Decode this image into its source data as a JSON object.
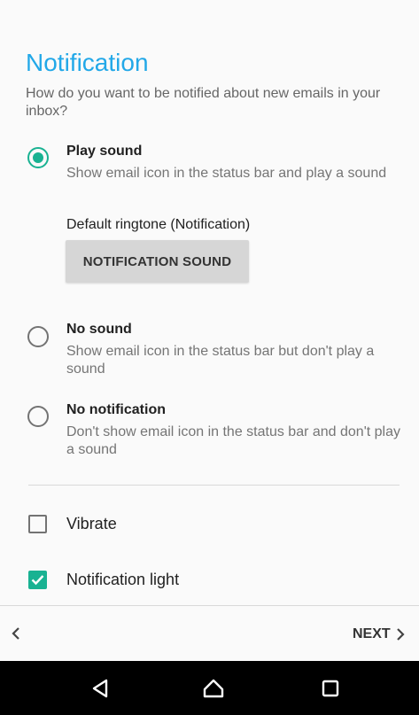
{
  "header": {
    "title": "Notification",
    "subtitle": "How do you want to be notified about new emails in your inbox?"
  },
  "options": [
    {
      "title": "Play sound",
      "description": "Show email icon in the status bar and play a sound",
      "selected": true
    },
    {
      "title": "No sound",
      "description": "Show email icon in the status bar but don't play a sound",
      "selected": false
    },
    {
      "title": "No notification",
      "description": "Don't show email icon in the status bar and don't play a sound",
      "selected": false
    }
  ],
  "ringtone": {
    "label": "Default ringtone (Notification)",
    "button_label": "NOTIFICATION SOUND"
  },
  "checkboxes": [
    {
      "label": "Vibrate",
      "checked": false
    },
    {
      "label": "Notification light",
      "checked": true
    }
  ],
  "footer": {
    "back_icon": "chevron-left-icon",
    "next_label": "NEXT",
    "next_icon": "chevron-right-icon"
  },
  "navbar": {
    "icons": [
      "back-triangle-icon",
      "home-icon",
      "recents-square-icon"
    ]
  },
  "colors": {
    "accent": "#19b292",
    "title": "#22a8e8",
    "navbar": "#000000"
  }
}
